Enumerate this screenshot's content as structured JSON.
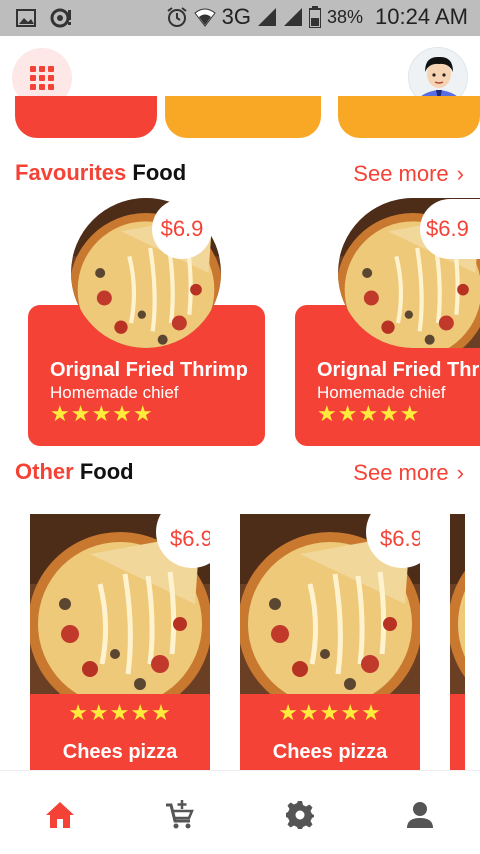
{
  "status_bar": {
    "network": "3G",
    "battery": "38%",
    "time": "10:24 AM"
  },
  "header": {
    "menu_icon": "grid-menu-icon",
    "avatar_icon": "user-avatar"
  },
  "sections": {
    "favourites": {
      "title_accent": "Favourites",
      "title_plain": "Food",
      "see_more": "See more",
      "items": [
        {
          "name": "Orignal Fried Thrimp",
          "subtitle": "Homemade chief",
          "price": "$6.9",
          "stars": "★★★★★"
        },
        {
          "name": "Orignal Fried Thrimp",
          "subtitle": "Homemade chief",
          "price": "$6.9",
          "stars": "★★★★★"
        }
      ]
    },
    "other": {
      "title_accent": "Other",
      "title_plain": "Food",
      "see_more": "See more",
      "items": [
        {
          "name": "Chees pizza",
          "price": "$6.9",
          "stars": "★★★★★"
        },
        {
          "name": "Chees pizza",
          "price": "$6.9",
          "stars": "★★★★★"
        }
      ]
    }
  },
  "bottom_nav": [
    {
      "icon": "home-icon",
      "active": true
    },
    {
      "icon": "add-to-cart-icon",
      "active": false
    },
    {
      "icon": "settings-icon",
      "active": false
    },
    {
      "icon": "profile-icon",
      "active": false
    }
  ],
  "colors": {
    "accent": "#f44336",
    "yellow": "#f9a825",
    "star": "#ffeb3b",
    "inactive_icon": "#555555"
  }
}
